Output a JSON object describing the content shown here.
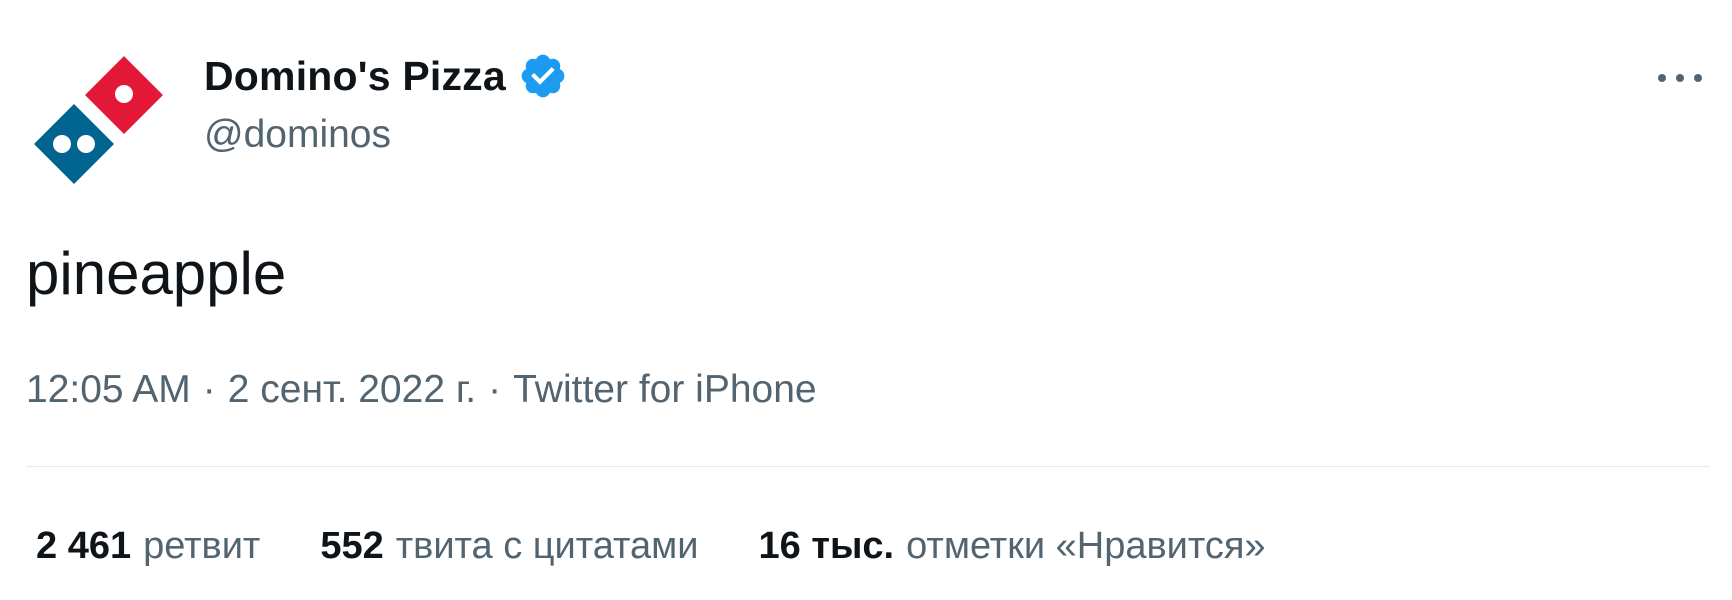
{
  "author": {
    "display_name": "Domino's Pizza",
    "handle": "@dominos",
    "verified": true,
    "avatar_icon": "dominos-logo-icon",
    "colors": {
      "red": "#e31837",
      "blue": "#006491",
      "verified": "#1d9bf0"
    }
  },
  "tweet": {
    "text": "pineapple",
    "time": "12:05 AM",
    "date": "2 сент. 2022 г.",
    "source": "Twitter for iPhone",
    "separator": "·"
  },
  "stats": {
    "retweets": {
      "count": "2 461",
      "label": "ретвит"
    },
    "quotes": {
      "count": "552",
      "label": "твита с цитатами"
    },
    "likes": {
      "count": "16 тыс.",
      "label": "отметки «Нравится»"
    }
  },
  "menu": {
    "icon": "more-options-icon"
  },
  "theme": {
    "text": "#0f1419",
    "secondary": "#536471",
    "divider": "#e7e9ea"
  }
}
